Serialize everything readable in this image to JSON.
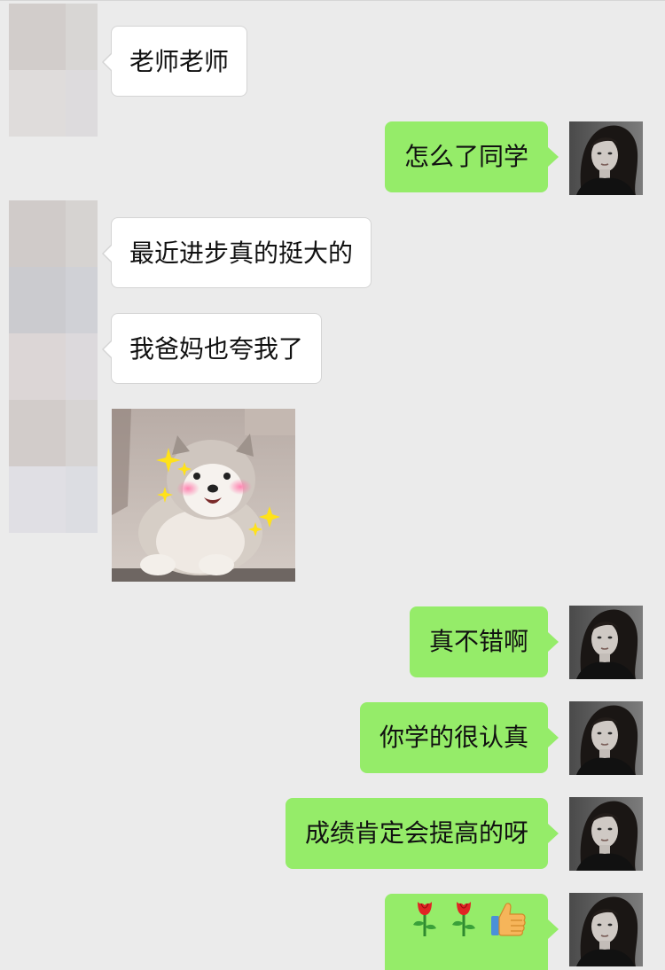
{
  "colors": {
    "background": "#ebebeb",
    "incoming_bubble": "#ffffff",
    "outgoing_bubble": "#95ec69"
  },
  "messages": [
    {
      "side": "incoming",
      "type": "text",
      "text": "老师老师"
    },
    {
      "side": "outgoing",
      "type": "text",
      "text": "怎么了同学"
    },
    {
      "side": "incoming",
      "type": "text",
      "text": "最近进步真的挺大的"
    },
    {
      "side": "incoming",
      "type": "text",
      "text": "我爸妈也夸我了"
    },
    {
      "side": "incoming",
      "type": "sticker",
      "sticker": "happy-puppy-sparkles"
    },
    {
      "side": "outgoing",
      "type": "text",
      "text": "真不错啊"
    },
    {
      "side": "outgoing",
      "type": "text",
      "text": "你学的很认真"
    },
    {
      "side": "outgoing",
      "type": "text",
      "text": "成绩肯定会提高的呀"
    },
    {
      "side": "outgoing",
      "type": "emoji",
      "emojis": [
        "rose-icon",
        "rose-icon",
        "thumbs-up-icon"
      ]
    }
  ]
}
